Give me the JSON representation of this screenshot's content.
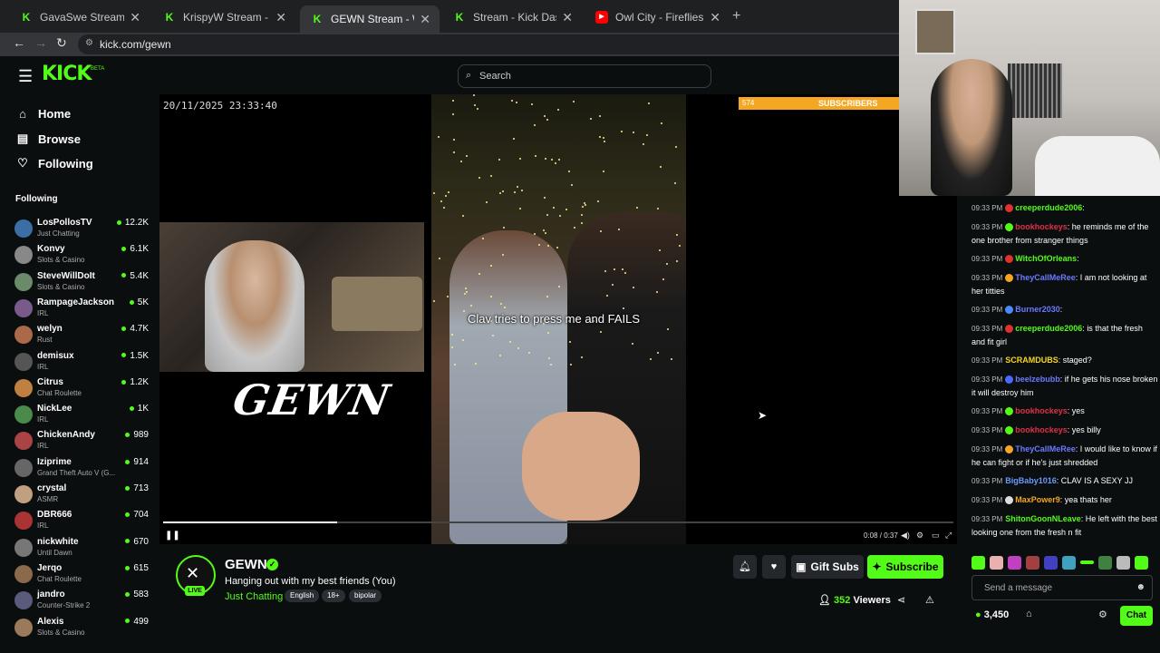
{
  "browser": {
    "tabs": [
      {
        "title": "GavaSwe Stream - Watch Live on Kick",
        "favicon": "kick-icon"
      },
      {
        "title": "KrispyW Stream - Watch Live on Kick",
        "favicon": "kick-icon"
      },
      {
        "title": "GEWN Stream - Watch Live on Kick",
        "favicon": "kick-icon",
        "active": true
      },
      {
        "title": "Stream - Kick Dashboard",
        "favicon": "kick-icon"
      },
      {
        "title": "Owl City - Fireflies (Lyrics) - YouTube",
        "favicon": "youtube-icon"
      }
    ],
    "url": "kick.com/gewn"
  },
  "kick": {
    "logo": "KICK",
    "logo_badge": "BETA",
    "search_placeholder": "Search",
    "nav": [
      {
        "label": "Home",
        "icon": "home-icon"
      },
      {
        "label": "Browse",
        "icon": "browse-icon"
      },
      {
        "label": "Following",
        "icon": "heart-icon"
      }
    ],
    "following_heading": "Following",
    "following": [
      {
        "name": "LosPollosTV",
        "category": "Just Chatting",
        "viewers": "12.2K",
        "color": "#3a6ea5"
      },
      {
        "name": "Konvy",
        "category": "Slots & Casino",
        "viewers": "6.1K",
        "color": "#888888"
      },
      {
        "name": "SteveWillDoIt",
        "category": "Slots & Casino",
        "viewers": "5.4K",
        "color": "#6a8a6a"
      },
      {
        "name": "RampageJackson",
        "category": "IRL",
        "viewers": "5K",
        "color": "#7a5a8a"
      },
      {
        "name": "welyn",
        "category": "Rust",
        "viewers": "4.7K",
        "color": "#aa6a4a"
      },
      {
        "name": "demisux",
        "category": "IRL",
        "viewers": "1.5K",
        "color": "#555555"
      },
      {
        "name": "Citrus",
        "category": "Chat Roulette",
        "viewers": "1.2K",
        "color": "#c08040"
      },
      {
        "name": "NickLee",
        "category": "IRL",
        "viewers": "1K",
        "color": "#4a8a4a"
      },
      {
        "name": "ChickenAndy",
        "category": "IRL",
        "viewers": "989",
        "color": "#aa4444"
      },
      {
        "name": "Iziprime",
        "category": "Grand Theft Auto V (G...",
        "viewers": "914",
        "color": "#666666"
      },
      {
        "name": "crystal",
        "category": "ASMR",
        "viewers": "713",
        "color": "#c0a080"
      },
      {
        "name": "DBR666",
        "category": "IRL",
        "viewers": "704",
        "color": "#aa3333"
      },
      {
        "name": "nickwhite",
        "category": "Until Dawn",
        "viewers": "670",
        "color": "#777777"
      },
      {
        "name": "Jerqo",
        "category": "Chat Roulette",
        "viewers": "615",
        "color": "#8a6a4a"
      },
      {
        "name": "jandro",
        "category": "Counter-Strike 2",
        "viewers": "583",
        "color": "#5a5a7a"
      },
      {
        "name": "Alexis",
        "category": "Slots & Casino",
        "viewers": "499",
        "color": "#9a7a5a"
      }
    ]
  },
  "player": {
    "timestamp": "20/11/2025 23:33:40",
    "overlay_brand": "GEWN",
    "caption": "Clav tries to press me and FAILS",
    "sub_goal_count": "574",
    "sub_goal_label": "SUBSCRIBERS",
    "sub_goal_progress": 0.0,
    "time": "0:08 / 0:37",
    "playback_progress": 0.22
  },
  "stream": {
    "streamer": "GEWN",
    "live_label": "LIVE",
    "title": "Hanging out with my best friends (You)",
    "category": "Just Chatting",
    "tags": [
      "English",
      "18+",
      "bipolar"
    ],
    "gift_label": "Gift Subs",
    "subscribe_label": "Subscribe",
    "viewers_count": "352",
    "viewers_label": "Viewers"
  },
  "chat": {
    "messages": [
      {
        "time": "09:33 PM",
        "user": "creeperdude2006",
        "color": "#53fc18",
        "text": "",
        "badge": "#e03030"
      },
      {
        "time": "09:33 PM",
        "user": "bookhockeys",
        "color": "#e0304a",
        "text": "he reminds me of the one brother from stranger things",
        "badge": "#53fc18"
      },
      {
        "time": "09:33 PM",
        "user": "WitchOfOrleans",
        "color": "#53fc18",
        "text": "",
        "badge": "#e03030"
      },
      {
        "time": "09:33 PM",
        "user": "TheyCallMeRee",
        "color": "#6a7bff",
        "text": "I am not looking at her titties",
        "badge": "#f5a623"
      },
      {
        "time": "09:33 PM",
        "user": "Burner2030",
        "color": "#6a7bff",
        "text": "",
        "badge": "#4a8aff"
      },
      {
        "time": "09:33 PM",
        "user": "creeperdude2006",
        "color": "#53fc18",
        "text": "is that the fresh and fit girl",
        "badge": "#e03030"
      },
      {
        "time": "09:33 PM",
        "user": "SCRAMDUBS",
        "color": "#f5d623",
        "text": "staged?",
        "badge": ""
      },
      {
        "time": "09:33 PM",
        "user": "beelzebubb",
        "color": "#6a7bff",
        "text": "if he gets his nose broken it will destroy him",
        "badge": "#4a6aff"
      },
      {
        "time": "09:33 PM",
        "user": "bookhockeys",
        "color": "#e0304a",
        "text": "yes",
        "badge": "#53fc18"
      },
      {
        "time": "09:33 PM",
        "user": "bookhockeys",
        "color": "#e0304a",
        "text": "yes billy",
        "badge": "#53fc18"
      },
      {
        "time": "09:33 PM",
        "user": "TheyCallMeRee",
        "color": "#6a7bff",
        "text": "I would like to know if he can fight or if he's just shredded",
        "badge": "#f5a623"
      },
      {
        "time": "09:33 PM",
        "user": "BigBaby1016",
        "color": "#6a9aff",
        "text": "CLAV IS A SEXY JJ",
        "badge": ""
      },
      {
        "time": "09:33 PM",
        "user": "MaxPower9",
        "color": "#f5a623",
        "text": "yea thats her",
        "badge": "#dddddd"
      },
      {
        "time": "09:33 PM",
        "user": "ShitonGoonNLeave",
        "color": "#53fc18",
        "text": "He left with the best looking one from the fresh n fit",
        "badge": ""
      }
    ],
    "input_placeholder": "Send a message",
    "points": "3,450",
    "chat_button": "Chat"
  }
}
